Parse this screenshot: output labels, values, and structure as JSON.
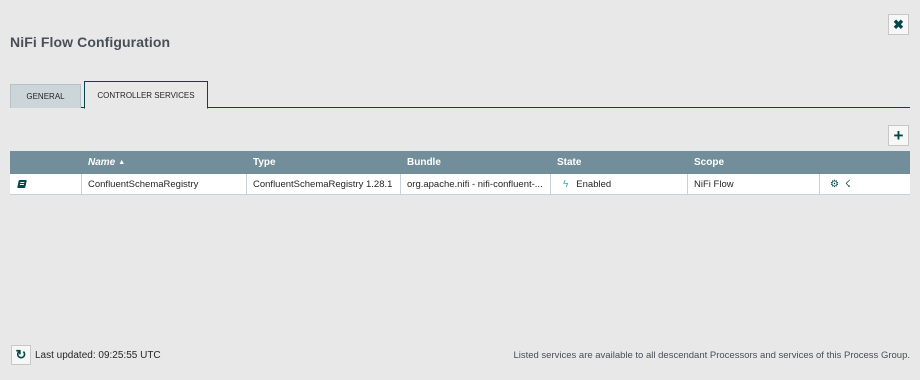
{
  "dialog": {
    "title": "NiFi Flow Configuration",
    "close_icon": "close-icon"
  },
  "tabs": [
    {
      "label": "GENERAL",
      "active": false
    },
    {
      "label": "CONTROLLER SERVICES",
      "active": true
    }
  ],
  "toolbar": {
    "add_icon": "plus-icon"
  },
  "grid": {
    "columns": [
      "",
      "Name",
      "Type",
      "Bundle",
      "State",
      "Scope",
      ""
    ],
    "sort_indicator": "▲",
    "rows": [
      {
        "name": "ConfluentSchemaRegistry",
        "type": "ConfluentSchemaRegistry 1.28.1",
        "bundle": "org.apache.nifi - nifi-confluent-...",
        "state": "Enabled",
        "scope": "NiFi Flow"
      }
    ]
  },
  "footer": {
    "last_updated_label": "Last updated:",
    "last_updated_value": "09:25:55 UTC",
    "note": "Listed services are available to all descendant Processors and services of this Process Group."
  },
  "colors": {
    "header_bg": "#728e9b",
    "accent": "#004849",
    "enabled_bolt": "#44a3cf"
  }
}
